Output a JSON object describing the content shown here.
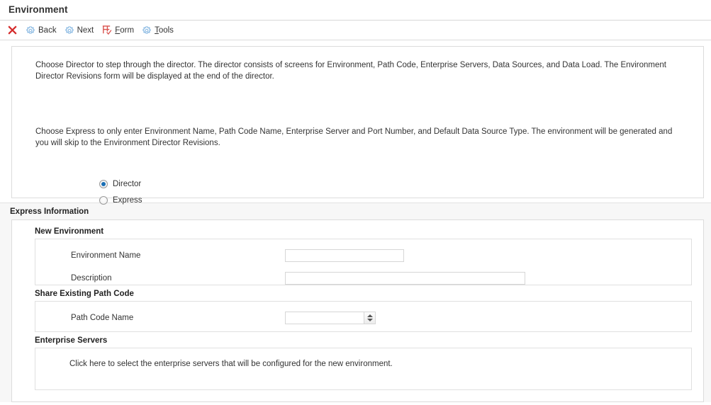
{
  "page": {
    "title": "Environment"
  },
  "toolbar": {
    "items": [
      {
        "icon": "close-icon",
        "label": "",
        "mnemonic": ""
      },
      {
        "icon": "gear-icon",
        "label": "Back",
        "mnemonic": ""
      },
      {
        "icon": "gear-icon",
        "label": "Next",
        "mnemonic": ""
      },
      {
        "icon": "form-icon",
        "label": "orm",
        "mnemonic": "F"
      },
      {
        "icon": "gear-icon",
        "label": "ools",
        "mnemonic": "T"
      }
    ]
  },
  "intro": {
    "paragraph1": "Choose Director to step through the director. The director consists of screens for Environment, Path Code, Enterprise Servers, Data Sources, and Data Load. The Environment Director Revisions form will be displayed at the end of the director.",
    "paragraph2": "Choose Express to only enter Environment Name, Path Code Name, Enterprise Server and Port Number, and Default Data Source Type. The environment will be generated and you will skip to the Environment Director Revisions."
  },
  "mode_options": [
    {
      "label": "Director",
      "selected": true
    },
    {
      "label": "Express",
      "selected": false
    }
  ],
  "express_information": {
    "title": "Express Information",
    "new_environment": {
      "title": "New Environment",
      "fields": [
        {
          "label": "Environment Name",
          "value": "",
          "placeholder": ""
        },
        {
          "label": "Description",
          "value": "",
          "placeholder": ""
        }
      ]
    },
    "share_existing_path_code": {
      "title": "Share Existing Path Code",
      "field": {
        "label": "Path Code Name",
        "value": "",
        "placeholder": ""
      }
    },
    "enterprise_servers": {
      "title": "Enterprise Servers",
      "hint": "Click here to select the enterprise servers that will be configured for the new environment."
    }
  },
  "colors": {
    "close_red": "#d42a2a",
    "gear_blue": "#7fb3e0",
    "form_red": "#d9534f",
    "radio_selected": "#1a6fb5",
    "band_bg": "#f7f7f7",
    "border": "#dcdcdc"
  }
}
